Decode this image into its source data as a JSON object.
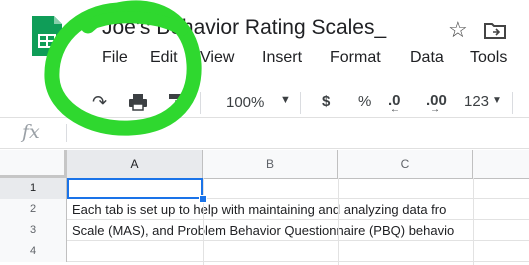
{
  "header": {
    "doc_title": "Joe's Behavior Rating Scales_",
    "star_icon": "star-icon",
    "folder_icon": "move-to-folder-icon"
  },
  "menu": [
    "File",
    "Edit",
    "View",
    "Insert",
    "Format",
    "Data",
    "Tools"
  ],
  "toolbar": {
    "redo_icon": "redo-icon",
    "print_icon": "print-icon",
    "paint_format_icon": "paint-format-icon",
    "zoom": "100%",
    "currency": "$",
    "percent": "%",
    "decrease_decimal": ".0",
    "increase_decimal": ".00",
    "number_format": "123"
  },
  "formula_bar": {
    "fx_label": "fx",
    "value": ""
  },
  "grid": {
    "columns": [
      "A",
      "B",
      "C"
    ],
    "rows": [
      {
        "num": "1",
        "text": ""
      },
      {
        "num": "2",
        "text": "Each tab is set up to help with maintaining and analyzing data fro"
      },
      {
        "num": "3",
        "text": "Scale (MAS), and Problem Behavior Questionnaire (PBQ) behavio"
      },
      {
        "num": "4",
        "text": ""
      }
    ],
    "selected_cell": "A1"
  },
  "colors": {
    "sheets_green": "#0f9d58",
    "scribble_green": "#2fd82f",
    "selection_blue": "#1a73e8"
  }
}
